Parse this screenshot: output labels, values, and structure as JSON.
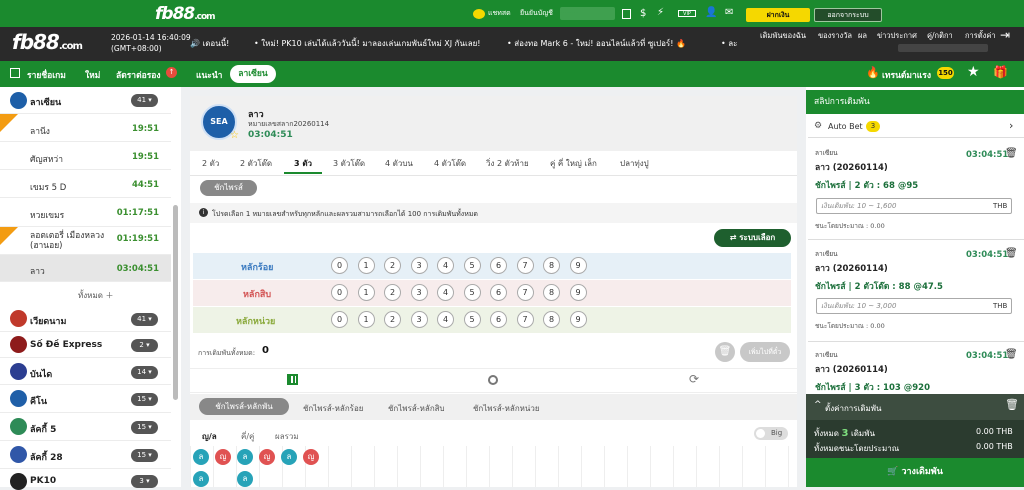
{
  "topbar": {
    "brand": "fb88",
    "brand_suffix": ".com",
    "chat_label": "แชทสด",
    "deposit_label": "ยืนยันบัญชี",
    "account_masked": "········",
    "deposit_btn": "ฝากเงิน",
    "logout_btn": "ออกจากระบบ"
  },
  "header": {
    "brand": "fb88",
    "brand_suffix": ".com",
    "datetime": "2026-01-14 16:40:09",
    "timezone": "(GMT+08:00)",
    "ticker_1": "🔊 เดอนนี้!",
    "ticker_2": "• ใหม่! PK10 เล่นได้แล้ววันนี้! มาลองเล่นเกมพันธ์ใหม่ XJ กันเลย!",
    "ticker_3": "• ส่องทอ Mark 6 - ใหม่! ออนไลน์แล้วที่ ซูเปอร์! 🔥",
    "ticker_4": "• ละ",
    "nav": [
      "เดิมพันของฉัน",
      "ของรางวัล",
      "ผล",
      "ข่าวประกาศ",
      "คู่/กติกา",
      "การตั้งค่า"
    ]
  },
  "navbar": {
    "items": [
      "รายชื่อเกม",
      "ใหม่",
      "ลัดราต่อรอง",
      "แนะนำ"
    ],
    "active": "ลาเซียน",
    "hot_label": "เทรนด์มาแรง",
    "hot_count": "150"
  },
  "sidebar": {
    "region": "ลาเซียน",
    "region_count": "41",
    "items": [
      {
        "label": "ลานีง",
        "time": "19:51"
      },
      {
        "label": "ศัญสหว่า",
        "time": "19:51"
      },
      {
        "label": "เขมร 5 D",
        "time": "44:51"
      },
      {
        "label": "หวยเขมร",
        "time": "01:17:51"
      },
      {
        "label": "ลอตเตอรี่ เมืองหลวง (ฮานอย)",
        "time": "01:19:51"
      },
      {
        "label": "ลาว",
        "time": "03:04:51"
      }
    ],
    "show_all": "ทั้งหมด",
    "categories": [
      {
        "label": "เวียดนาม",
        "count": "41",
        "color": "#c0392b"
      },
      {
        "label": "Số Đề Express",
        "count": "2",
        "color": "#8e1b1b"
      },
      {
        "label": "บันได",
        "count": "14",
        "color": "#2c3e91"
      },
      {
        "label": "คีโน",
        "count": "15",
        "color": "#1f5fa8"
      },
      {
        "label": "ลัคกี้ 5",
        "count": "15",
        "color": "#2e8b57"
      },
      {
        "label": "ลัคกี้ 28",
        "count": "15",
        "color": "#3057a8"
      },
      {
        "label": "PK10",
        "count": "3",
        "color": "#222"
      }
    ]
  },
  "game": {
    "name": "ลาว",
    "draw_no": "หมายเลขสลาก20260114",
    "countdown": "03:04:51",
    "tabs": [
      "2 ตัว",
      "2 ตัวโต๊ด",
      "3 ตัว",
      "3 ตัวโต๊ด",
      "4 ตัวบน",
      "4 ตัวโต๊ด",
      "วิ่ง 2 ตัวท้าย",
      "คู่ คี่ ใหญ่ เล็ก",
      "ปลาทุ่งปู"
    ],
    "active_tab": "3 ตัว",
    "sub_tab": "ชักไพรส์",
    "hint": "โปรดเลือก 1 หมายเลขสำหรับทุกหลักและผลรวมสามารถเลือกได้ 100 การเดิมพันทั้งหมด",
    "random_btn": "ระบบเลือก",
    "rows": [
      "หลักร้อย",
      "หลักสิบ",
      "หลักหน่วย"
    ],
    "digits": [
      "0",
      "1",
      "2",
      "3",
      "4",
      "5",
      "6",
      "7",
      "8",
      "9"
    ],
    "total_label": "การเดิมพันทั้งหมด:",
    "total_value": "0",
    "add_btn": "เพิ่มไปที่ตั๋ว",
    "combo_tabs": [
      "ชักไพรส์-หลักพัน",
      "ชักไพรส์-หลักร้อย",
      "ชักไพรส์-หลักสิบ",
      "ชักไพรส์-หลักหน่วย"
    ],
    "filter_tabs": [
      "ญ/ล",
      "คี่/คู่",
      "ผลรวม"
    ],
    "big_label": "Big",
    "history": [
      "ล",
      "ญ",
      "ล",
      "ญ",
      "ล",
      "ญ"
    ]
  },
  "betslip": {
    "title": "สลิปการเดิมพัน",
    "autobet": "Auto Bet",
    "autobet_count": "3",
    "cards": [
      {
        "region": "ลาเซียน",
        "time": "03:04:51",
        "game": "ลาว (20260114)",
        "detail": "ชักไพรส์ | 2 ตัว : 68 @95",
        "placeholder": "เงินเดิมพัน: 10 ~ 1,600",
        "est": "ชนะโดยประมาณ : 0.00"
      },
      {
        "region": "ลาเซียน",
        "time": "03:04:51",
        "game": "ลาว (20260114)",
        "detail": "ชักไพรส์ | 2 ตัวโต๊ด : 88 @47.5",
        "placeholder": "เงินเดิมพัน: 10 ~ 3,000",
        "est": "ชนะโดยประมาณ : 0.00"
      },
      {
        "region": "ลาเซียน",
        "time": "03:04:51",
        "game": "ลาว (20260114)",
        "detail": "ชักไพรส์ | 3 ตัว : 103 @920"
      }
    ],
    "currency": "THB",
    "settings": "ตั้งค่าการเดิมพัน",
    "total_label": "ทั้งหมด",
    "total_count": "3",
    "bets_label": "เดิมพัน",
    "total_amount": "0.00 THB",
    "est_label": "ทั้งหมดชนะโดยประมาณ",
    "est_amount": "0.00 THB",
    "place_btn": "วางเดิมพัน"
  }
}
